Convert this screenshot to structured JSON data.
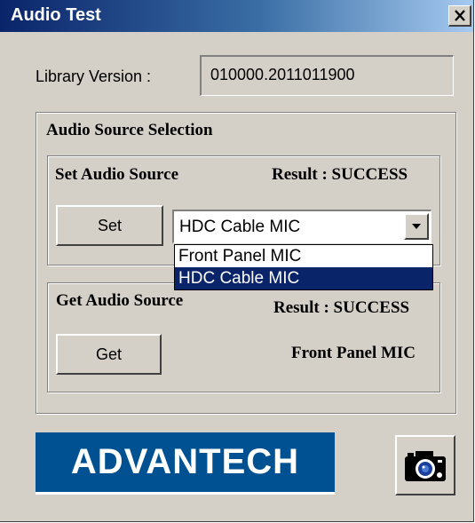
{
  "window": {
    "title": "Audio Test",
    "close_glyph": "✕"
  },
  "library": {
    "label": "Library Version :",
    "value": "010000.2011011900"
  },
  "source_group": {
    "title": "Audio Source Selection"
  },
  "set_group": {
    "title": "Set Audio Source",
    "result": "Result : SUCCESS",
    "button_label": "Set",
    "selected": "HDC Cable MIC",
    "options": [
      "Front Panel MIC",
      "HDC Cable MIC"
    ],
    "highlighted_index": 1
  },
  "get_group": {
    "title": "Get Audio Source",
    "result": "Result : SUCCESS",
    "button_label": "Get",
    "value": "Front Panel MIC"
  },
  "logo": {
    "text": "ADVANTECH",
    "color": "#005192"
  },
  "icons": {
    "capture_button": "camera-icon",
    "combo_arrow": "chevron-down-icon"
  },
  "colors": {
    "titlebar": "#0a246a",
    "face": "#d4d0c8",
    "selection": "#0a246a"
  }
}
